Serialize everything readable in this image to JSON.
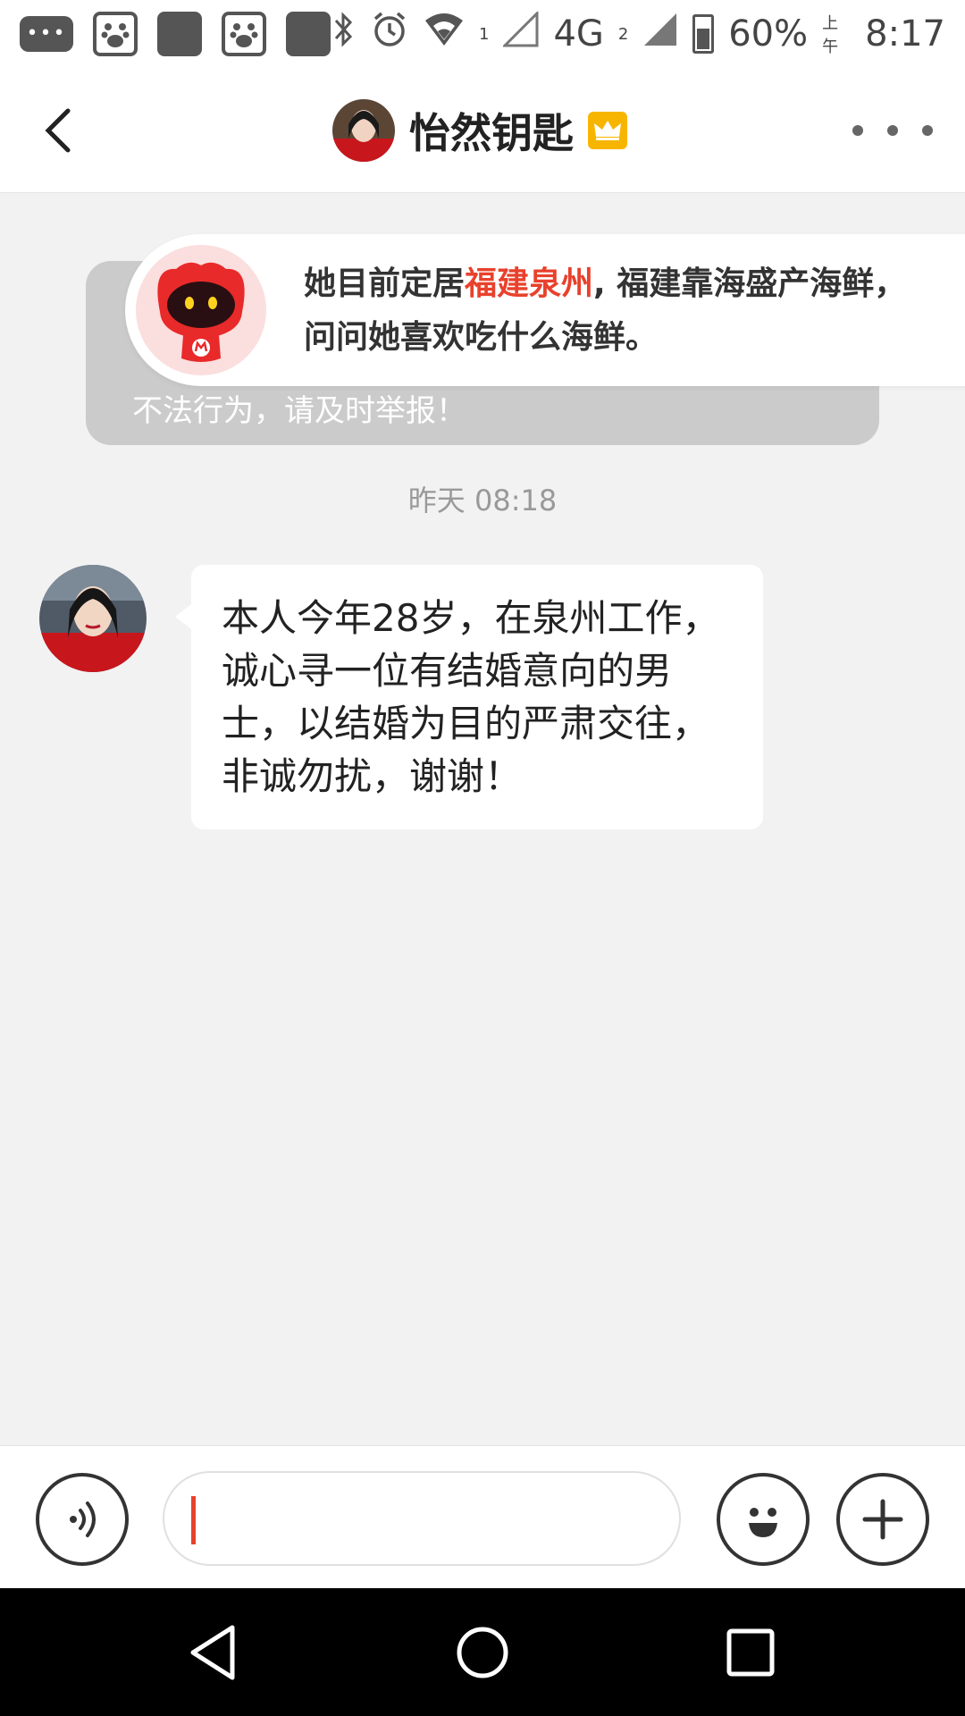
{
  "status_bar": {
    "network": "4G",
    "sim1": "1",
    "sim2": "2",
    "battery": "60%",
    "ampm": "上午",
    "time": "8:17",
    "icons": [
      "message-icon",
      "baidu-icon",
      "app-icon",
      "baidu-icon",
      "app-icon",
      "bluetooth-icon",
      "alarm-icon",
      "wifi-icon",
      "signal-icon",
      "battery-icon"
    ]
  },
  "header": {
    "title": "怡然钥匙",
    "icons": {
      "back": "chevron-left-icon",
      "badge": "crown-icon",
      "more": "more-dots-icon"
    }
  },
  "notice": {
    "text": "不法行为，请及时举报！"
  },
  "tip": {
    "text_before": "她目前定居",
    "highlight": "福建泉州",
    "text_after": ", 福建靠海盛产海鲜，问问她喜欢吃什么海鲜。",
    "highlight_color": "#e8412c"
  },
  "timestamp": "昨天 08:18",
  "message": {
    "text": "本人今年28岁，在泉州工作，诚心寻一位有结婚意向的男士，以结婚为目的严肃交往，非诚勿扰，谢谢！"
  },
  "input_bar": {
    "value": "",
    "icons": {
      "voice": "voice-icon",
      "emoji": "emoji-icon",
      "plus": "plus-icon"
    }
  },
  "nav": {
    "icons": [
      "nav-back-icon",
      "nav-home-icon",
      "nav-recent-icon"
    ]
  },
  "colors": {
    "accent": "#e8412c",
    "vip": "#f7b500",
    "background": "#f2f2f2"
  }
}
